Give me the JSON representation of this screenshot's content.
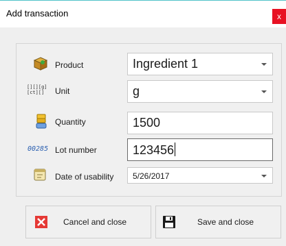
{
  "window": {
    "title": "Add transaction",
    "close_glyph": "x"
  },
  "form": {
    "product": {
      "label": "Product",
      "value": "Ingredient 1",
      "icon": "product-box-icon"
    },
    "unit": {
      "label": "Unit",
      "value": "g",
      "icon": "unit-icon",
      "icon_text_top": "[][][g]",
      "icon_text_bottom": "[ct][]"
    },
    "quantity": {
      "label": "Quantity",
      "value": "1500",
      "icon": "quantity-icon"
    },
    "lot_number": {
      "label": "Lot number",
      "value": "123456",
      "icon": "lot-number-icon",
      "icon_text": "00285"
    },
    "date_of_usability": {
      "label": "Date of usability",
      "value": "5/26/2017",
      "icon": "calendar-icon"
    }
  },
  "buttons": {
    "cancel": {
      "label": "Cancel and close",
      "icon": "cancel-x-icon"
    },
    "save": {
      "label": "Save and close",
      "icon": "floppy-disk-icon"
    }
  },
  "colors": {
    "close_red": "#e81123",
    "cancel_red": "#e53935",
    "lot_blue": "#2a5fb0",
    "accent_top_border": "#4fc3c8"
  }
}
